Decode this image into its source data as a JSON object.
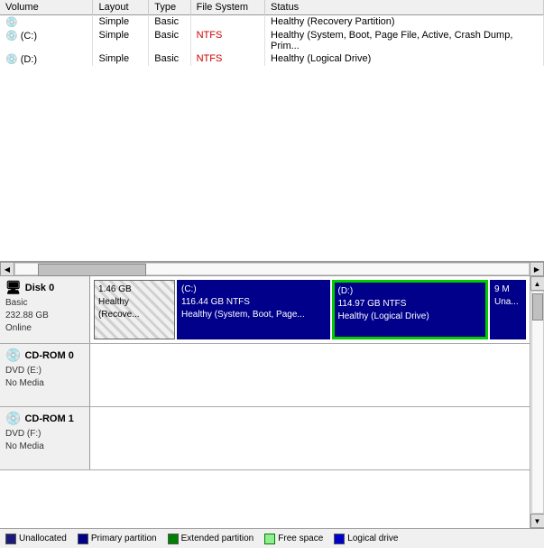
{
  "table": {
    "columns": [
      "Volume",
      "Layout",
      "Type",
      "File System",
      "Status"
    ],
    "rows": [
      {
        "volume": "",
        "layout": "Simple",
        "type": "Basic",
        "filesystem": "",
        "status": "Healthy (Recovery Partition)"
      },
      {
        "volume": "(C:)",
        "layout": "Simple",
        "type": "Basic",
        "filesystem": "NTFS",
        "status": "Healthy (System, Boot, Page File, Active, Crash Dump, Prim..."
      },
      {
        "volume": "(D:)",
        "layout": "Simple",
        "type": "Basic",
        "filesystem": "NTFS",
        "status": "Healthy (Logical Drive)"
      }
    ]
  },
  "disks": [
    {
      "id": "disk0",
      "label": "Disk 0",
      "sublabel1": "Basic",
      "sublabel2": "232.88 GB",
      "sublabel3": "Online",
      "partitions": [
        {
          "id": "recovery",
          "size": "1.46 GB",
          "label": "Healthy (Recove...",
          "type": "recovery"
        },
        {
          "id": "c",
          "size": "(C:)",
          "size2": "116.44 GB NTFS",
          "label": "Healthy (System, Boot, Page...",
          "type": "primary"
        },
        {
          "id": "d",
          "size": "(D:)",
          "size2": "114.97 GB NTFS",
          "label": "Healthy (Logical Drive)",
          "type": "logical"
        },
        {
          "id": "small",
          "size": "9 M",
          "label": "Una...",
          "type": "small"
        }
      ]
    }
  ],
  "cdroms": [
    {
      "id": "cdrom0",
      "label": "CD-ROM 0",
      "sublabel1": "DVD (E:)",
      "sublabel2": "",
      "sublabel3": "No Media"
    },
    {
      "id": "cdrom1",
      "label": "CD-ROM 1",
      "sublabel1": "DVD (F:)",
      "sublabel2": "",
      "sublabel3": "No Media"
    }
  ],
  "legend": [
    {
      "id": "unallocated",
      "label": "Unallocated",
      "color": "#1a1a7a"
    },
    {
      "id": "primary",
      "label": "Primary partition",
      "color": "#00008b"
    },
    {
      "id": "extended",
      "label": "Extended partition",
      "color": "#008000"
    },
    {
      "id": "freespace",
      "label": "Free space",
      "color": "#90ee90"
    },
    {
      "id": "logical",
      "label": "Logical drive",
      "color": "#0000cd"
    }
  ]
}
